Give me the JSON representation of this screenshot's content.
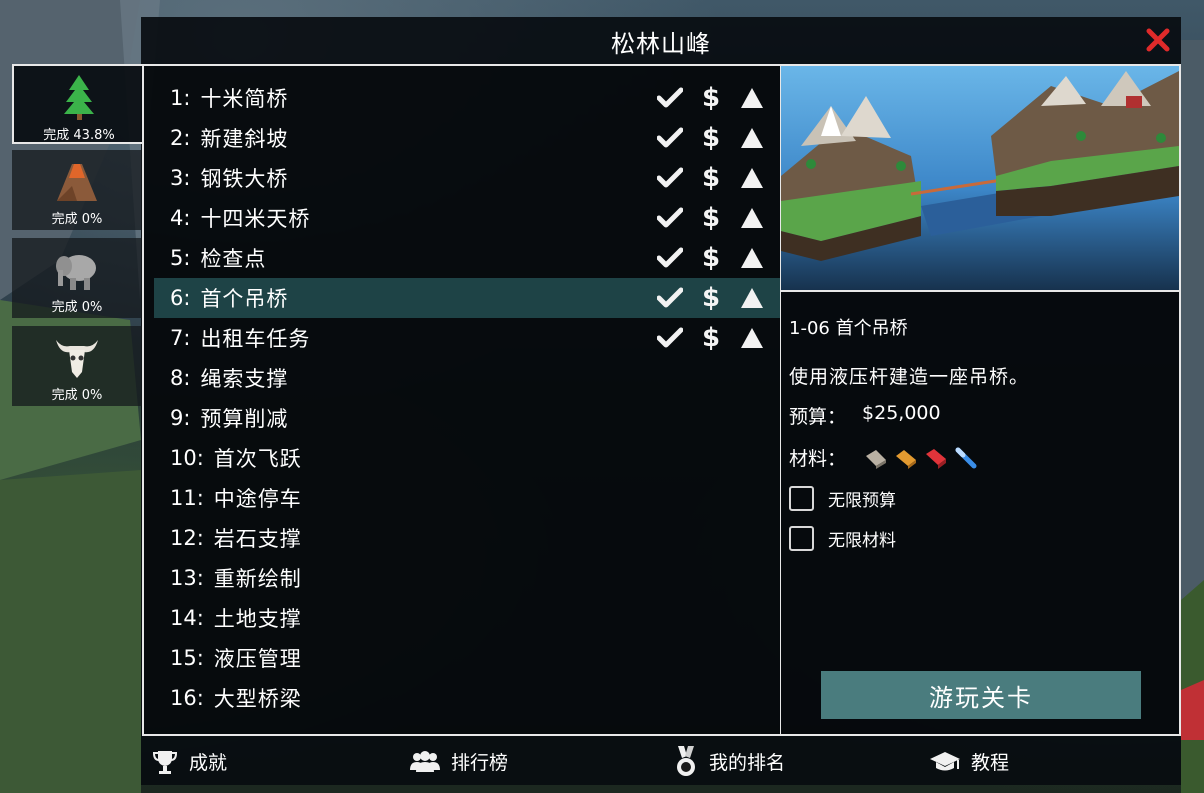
{
  "title": "松林山峰",
  "close_icon": "close-x-icon",
  "accent_colors": {
    "selected_row": "#1e4346",
    "play_button": "#4a7c7e",
    "close": "#e02a2a"
  },
  "worlds": [
    {
      "icon": "pine-tree-icon",
      "progress": "完成 43.8%",
      "active": true
    },
    {
      "icon": "volcano-icon",
      "progress": "完成 0%",
      "active": false
    },
    {
      "icon": "elephant-icon",
      "progress": "完成 0%",
      "active": false
    },
    {
      "icon": "bull-skull-icon",
      "progress": "完成 0%",
      "active": false
    }
  ],
  "levels": [
    {
      "num": "1:",
      "name": "十米简桥",
      "done": true
    },
    {
      "num": "2:",
      "name": "新建斜坡",
      "done": true
    },
    {
      "num": "3:",
      "name": "钢铁大桥",
      "done": true
    },
    {
      "num": "4:",
      "name": "十四米天桥",
      "done": true
    },
    {
      "num": "5:",
      "name": "检查点",
      "done": true
    },
    {
      "num": "6:",
      "name": "首个吊桥",
      "done": true,
      "selected": true
    },
    {
      "num": "7:",
      "name": "出租车任务",
      "done": true
    },
    {
      "num": "8:",
      "name": "绳索支撑",
      "done": false
    },
    {
      "num": "9:",
      "name": "预算削减",
      "done": false
    },
    {
      "num": "10:",
      "name": "首次飞跃",
      "done": false
    },
    {
      "num": "11:",
      "name": "中途停车",
      "done": false
    },
    {
      "num": "12:",
      "name": "岩石支撑",
      "done": false
    },
    {
      "num": "13:",
      "name": "重新绘制",
      "done": false
    },
    {
      "num": "14:",
      "name": "土地支撑",
      "done": false
    },
    {
      "num": "15:",
      "name": "液压管理",
      "done": false
    },
    {
      "num": "16:",
      "name": "大型桥梁",
      "done": false
    }
  ],
  "row_icons": {
    "check": "checkmark-icon",
    "dollar": "$",
    "triangle": "triangle-icon"
  },
  "detail": {
    "code": "1-06  首个吊桥",
    "description": "使用液压杆建造一座吊桥。",
    "budget_label": "预算：",
    "budget_value": "$25,000",
    "materials_label": "材料：",
    "materials": [
      "road-material-icon",
      "wood-material-icon",
      "hydraulic-material-icon",
      "rope-material-icon"
    ],
    "option_unlimited_budget": "无限预算",
    "option_unlimited_materials": "无限材料",
    "play_label": "游玩关卡"
  },
  "bottom_bar": {
    "achievements": "成就",
    "leaderboard": "排行榜",
    "my_rank": "我的排名",
    "tutorial": "教程"
  }
}
